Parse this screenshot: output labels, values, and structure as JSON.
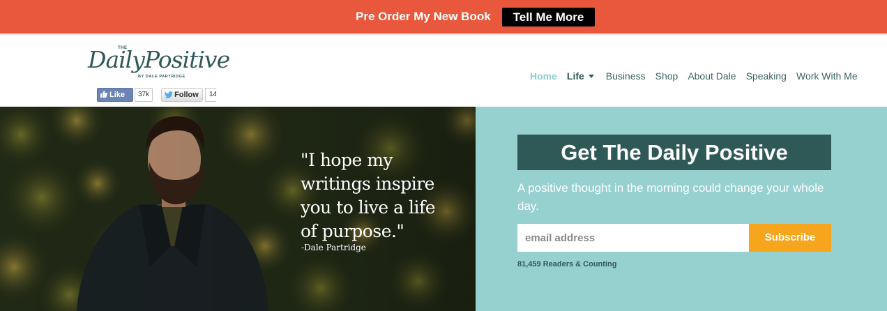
{
  "banner": {
    "text": "Pre Order My New Book",
    "button_label": "Tell Me More",
    "background_color": "#E9583C"
  },
  "logo": {
    "the": "THE",
    "name": "DailyPositive",
    "byline": "BY DALE PARTRIDGE",
    "color": "#2F5957"
  },
  "social": {
    "like_label": "Like",
    "like_count": "37k",
    "follow_label": "Follow",
    "follow_count": "14"
  },
  "nav": {
    "items": [
      {
        "label": "Home",
        "active": true
      },
      {
        "label": "Life",
        "has_dropdown": true
      },
      {
        "label": "Business"
      },
      {
        "label": "Shop"
      },
      {
        "label": "About Dale"
      },
      {
        "label": "Speaking"
      },
      {
        "label": "Work With Me"
      }
    ]
  },
  "hero": {
    "quote_lines": [
      "\"I hope my",
      "writings inspire",
      "you to live a life",
      "of purpose.\""
    ],
    "quote_author": "-Dale Partridge"
  },
  "signup": {
    "title": "Get The Daily Positive",
    "subtitle": "A positive thought in the morning could change your whole day.",
    "email_placeholder": "email address",
    "subscribe_label": "Subscribe",
    "readers_text": "81,459 Readers & Counting",
    "panel_color": "#96D1D0",
    "title_bg_color": "#2F5957",
    "button_color": "#F7A51C"
  }
}
